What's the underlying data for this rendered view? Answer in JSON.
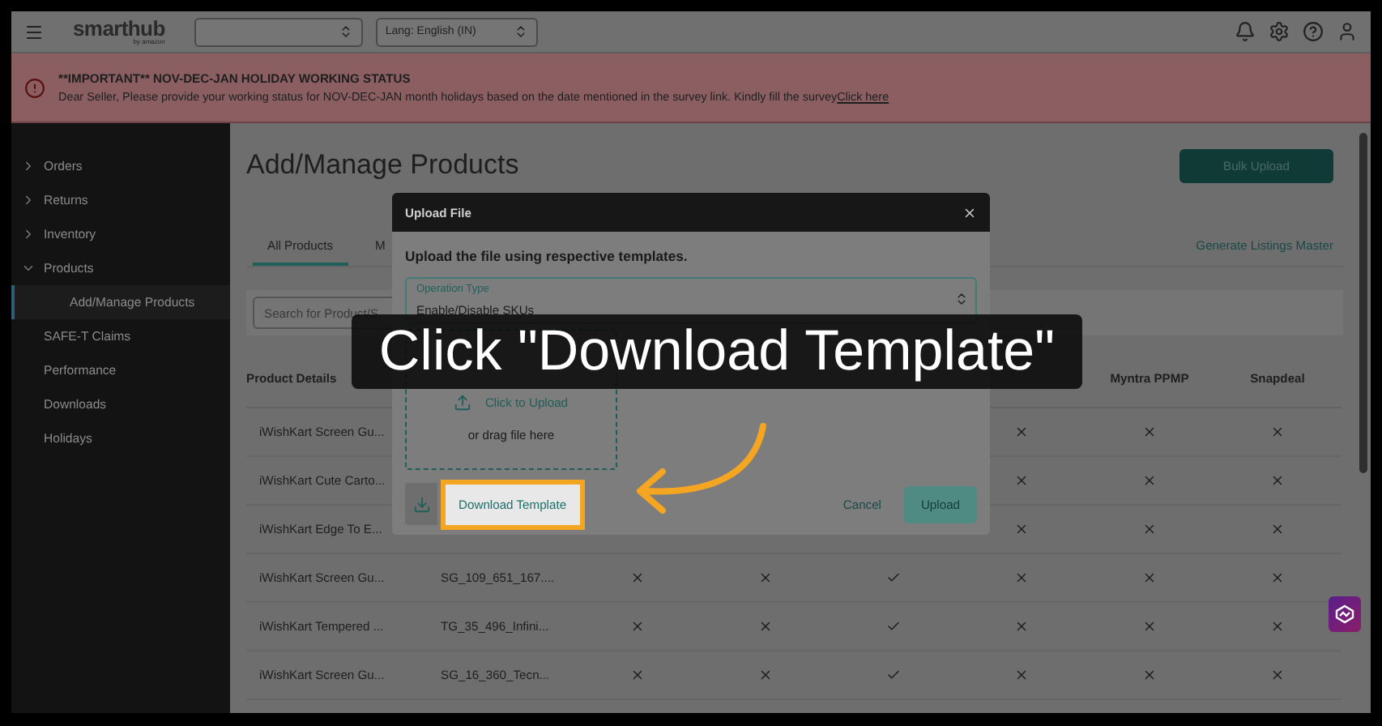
{
  "header": {
    "logo": "smarthub",
    "logo_tagline": "by amazon",
    "language_select": {
      "value": "Lang: English (IN)"
    }
  },
  "banner": {
    "title": "**IMPORTANT** NOV-DEC-JAN HOLIDAY WORKING STATUS",
    "message": "Dear Seller, Please provide your working status for NOV-DEC-JAN month holidays based on the date mentioned in the survey link. Kindly fill the survey",
    "link": "Click here"
  },
  "sidebar": {
    "items": [
      {
        "label": "Orders",
        "expanded": false,
        "selected": false
      },
      {
        "label": "Returns",
        "expanded": false,
        "selected": false
      },
      {
        "label": "Inventory",
        "expanded": false,
        "selected": false
      },
      {
        "label": "Products",
        "expanded": true,
        "selected": false,
        "children": [
          {
            "label": "Add/Manage Products",
            "selected": true
          }
        ]
      },
      {
        "label": "SAFE-T Claims",
        "selected": false
      },
      {
        "label": "Performance",
        "selected": false
      },
      {
        "label": "Downloads",
        "selected": false
      },
      {
        "label": "Holidays",
        "selected": false
      }
    ]
  },
  "page": {
    "title": "Add/Manage Products",
    "primary_button": "Bulk Upload",
    "tabs": [
      {
        "label": "All Products",
        "selected": true
      },
      {
        "label": "M",
        "selected": false
      }
    ],
    "link": "Generate Listings Master",
    "search": {
      "placeholder": "Search for Product/S"
    }
  },
  "table": {
    "columns": [
      "Product Details",
      null,
      null,
      null,
      null,
      null,
      "Myntra PPMP",
      "Snapdeal"
    ],
    "rows": [
      {
        "product": "iWishKart Screen Gu...",
        "marks": [
          false,
          false,
          false
        ]
      },
      {
        "product": "iWishKart Cute Carto...",
        "marks": [
          false,
          false,
          false
        ]
      },
      {
        "product": "iWishKart Edge To E...",
        "marks": [
          false,
          false,
          false
        ]
      },
      {
        "product": "iWishKart Screen Gu...",
        "sku": "SG_109_651_167....",
        "marks": [
          false,
          false,
          true,
          false,
          false,
          false
        ]
      },
      {
        "product": "iWishKart Tempered ...",
        "sku": "TG_35_496_Infini...",
        "marks": [
          false,
          false,
          true,
          false,
          false,
          false
        ]
      },
      {
        "product": "iWishKart Screen Gu...",
        "sku": "SG_16_360_Tecn...",
        "marks": [
          false,
          false,
          true,
          false,
          false,
          false
        ]
      }
    ]
  },
  "dialog": {
    "title": "Upload File",
    "instruction": "Upload the file using respective templates.",
    "select": {
      "label": "Operation Type",
      "value": "Enable/Disable SKUs"
    },
    "dropzone": {
      "action": "Click to Upload",
      "hint": "or drag file here"
    },
    "download_button": {
      "label": "Download Template",
      "highlighted": true
    },
    "cancel_button": "Cancel",
    "upload_button": {
      "label": "Upload",
      "disabled": true
    }
  },
  "callout": {
    "text": "Click \"Download Template\""
  }
}
